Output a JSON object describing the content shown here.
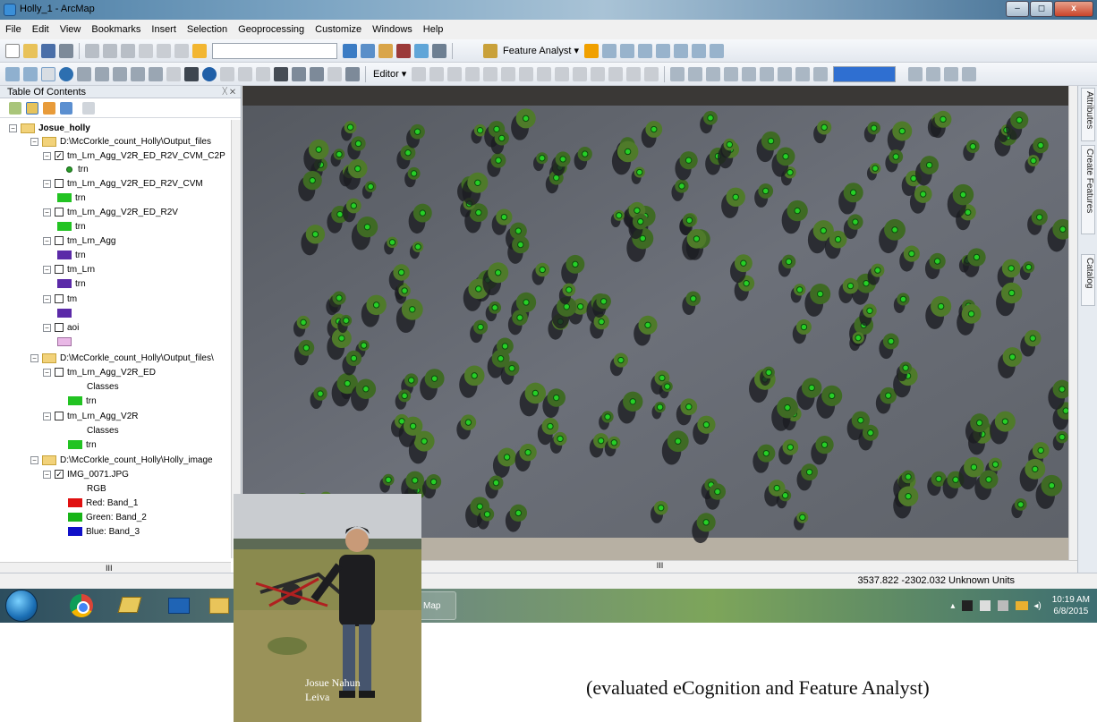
{
  "window": {
    "title": "Holly_1 - ArcMap",
    "controls": [
      "–",
      "◻",
      "x"
    ]
  },
  "menu": [
    "File",
    "Edit",
    "View",
    "Bookmarks",
    "Insert",
    "Selection",
    "Geoprocessing",
    "Customize",
    "Windows",
    "Help"
  ],
  "toolbar": {
    "feature_analyst_label": "Feature Analyst ▾",
    "editor_label": "Editor ▾"
  },
  "toc": {
    "title": "Table Of Contents",
    "pin": "ᚷ ✕",
    "rows": [
      {
        "text": "Josue_holly",
        "bold": true
      },
      {
        "text": "D:\\McCorkle_count_Holly\\Output_files"
      },
      {
        "text": "tm_Lrn_Agg_V2R_ED_R2V_CVM_C2P",
        "checked": true
      },
      {
        "text": "trn"
      },
      {
        "text": "tm_Lrn_Agg_V2R_ED_R2V_CVM"
      },
      {
        "text": "trn"
      },
      {
        "text": "tm_Lrn_Agg_V2R_ED_R2V"
      },
      {
        "text": "trn"
      },
      {
        "text": "tm_Lrn_Agg"
      },
      {
        "text": "trn"
      },
      {
        "text": "tm_Lrn"
      },
      {
        "text": "trn"
      },
      {
        "text": "tm"
      },
      {
        "text": "aoi"
      },
      {
        "text": "D:\\McCorkle_count_Holly\\Output_files\\"
      },
      {
        "text": "tm_Lrn_Agg_V2R_ED"
      },
      {
        "text": "Classes"
      },
      {
        "text": "trn"
      },
      {
        "text": "tm_Lrn_Agg_V2R"
      },
      {
        "text": "Classes"
      },
      {
        "text": "trn"
      },
      {
        "text": "D:\\McCorkle_count_Holly\\Holly_image"
      },
      {
        "text": "IMG_0071.JPG",
        "checked": true
      },
      {
        "text": "RGB"
      },
      {
        "text": "Red:   Band_1"
      },
      {
        "text": "Green: Band_2"
      },
      {
        "text": "Blue:  Band_3"
      }
    ],
    "hscroll_text": "III"
  },
  "colors": {
    "trn_green": "#22c322",
    "tm_purple": "#5b2aa8",
    "aoi_pink": "#e9b8e6",
    "red": "#e01010",
    "green": "#18b418",
    "blue": "#1010c8"
  },
  "side_tabs": [
    "Attributes",
    "Create Features",
    "Catalog"
  ],
  "map": {
    "hscroll_text": "III"
  },
  "status": {
    "coords": "3537.822  -2302.032 Unknown Units"
  },
  "taskbar": {
    "arcmap_label": "Map",
    "time": "10:19 AM",
    "date": "6/8/2015"
  },
  "photo": {
    "caption_line1": "Josue Nahun",
    "caption_line2": "Leiva"
  },
  "slide_caption": "(evaluated  eCognition  and  Feature Analyst)"
}
